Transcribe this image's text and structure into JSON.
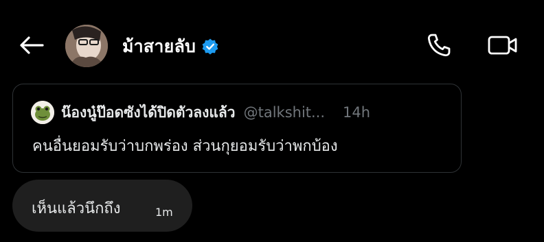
{
  "header": {
    "back_icon": "arrow-left-icon",
    "title": "ม้าสายลับ",
    "verified_icon": "verified-badge-icon",
    "call_icon": "phone-icon",
    "video_icon": "video-camera-icon"
  },
  "quoted_post": {
    "author_name": "น๊องนู๋ป๊อดซังได้ปิดตัวลงแล้ว",
    "handle": "@talkshit...",
    "time": "14h",
    "text": "คนอื่นยอมรับว่าบกพร่อง ส่วนกุยอมรับว่าพกบ้อง"
  },
  "message": {
    "text": "เห็นแล้วนึกถึง",
    "time": "1m"
  },
  "colors": {
    "background": "#000000",
    "verified": "#1d9bf0",
    "bubble": "#1f1f1f",
    "card_border": "#2f3336",
    "muted": "#71767b"
  }
}
